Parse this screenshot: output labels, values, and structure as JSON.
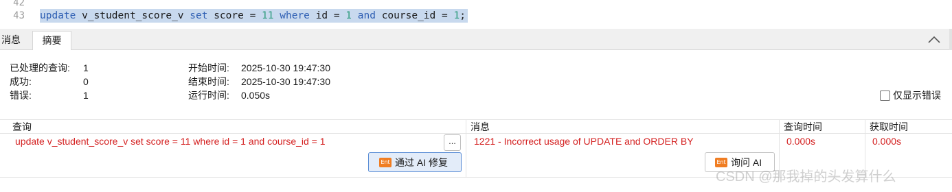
{
  "editor": {
    "line_numbers": [
      "42",
      "43"
    ],
    "sql_tokens": [
      {
        "text": "update",
        "type": "kw"
      },
      {
        "text": " v_student_score_v ",
        "type": "plain"
      },
      {
        "text": "set",
        "type": "kw"
      },
      {
        "text": " score = ",
        "type": "plain"
      },
      {
        "text": "11",
        "type": "num"
      },
      {
        "text": " ",
        "type": "plain"
      },
      {
        "text": "where",
        "type": "kw"
      },
      {
        "text": " id = ",
        "type": "plain"
      },
      {
        "text": "1",
        "type": "num"
      },
      {
        "text": " ",
        "type": "plain"
      },
      {
        "text": "and",
        "type": "kw"
      },
      {
        "text": " course_id = ",
        "type": "plain"
      },
      {
        "text": "1",
        "type": "num"
      },
      {
        "text": ";",
        "type": "plain"
      }
    ]
  },
  "tabs": {
    "messages": "消息",
    "summary": "摘要"
  },
  "summary": {
    "processed_label": "已处理的查询:",
    "processed_value": "1",
    "success_label": "成功:",
    "success_value": "0",
    "error_label": "错误:",
    "error_value": "1",
    "start_label": "开始时间:",
    "start_value": "2025-10-30 19:47:30",
    "end_label": "结束时间:",
    "end_value": "2025-10-30 19:47:30",
    "runtime_label": "运行时间:",
    "runtime_value": "0.050s",
    "show_errors_only": "仅显示错误",
    "show_errors_checked": false
  },
  "results": {
    "columns": [
      "查询",
      "消息",
      "查询时间",
      "获取时间"
    ],
    "row": {
      "query": "update v_student_score_v set score = 11 where id = 1 and course_id = 1",
      "message": "1221 - Incorrect usage of UPDATE and ORDER BY",
      "query_time": "0.000s",
      "fetch_time": "0.000s"
    },
    "more_label": "...",
    "fix_ai_label": "通过 AI 修复",
    "ask_ai_label": "询问 AI",
    "ent_badge": "Ent"
  },
  "watermark": "CSDN @那我掉的头发算什么",
  "colors": {
    "error_text": "#d42020",
    "keyword": "#2f5fb3",
    "number": "#2a9a7a",
    "selection": "#c8d9ee",
    "ai_badge": "#f07d22"
  }
}
